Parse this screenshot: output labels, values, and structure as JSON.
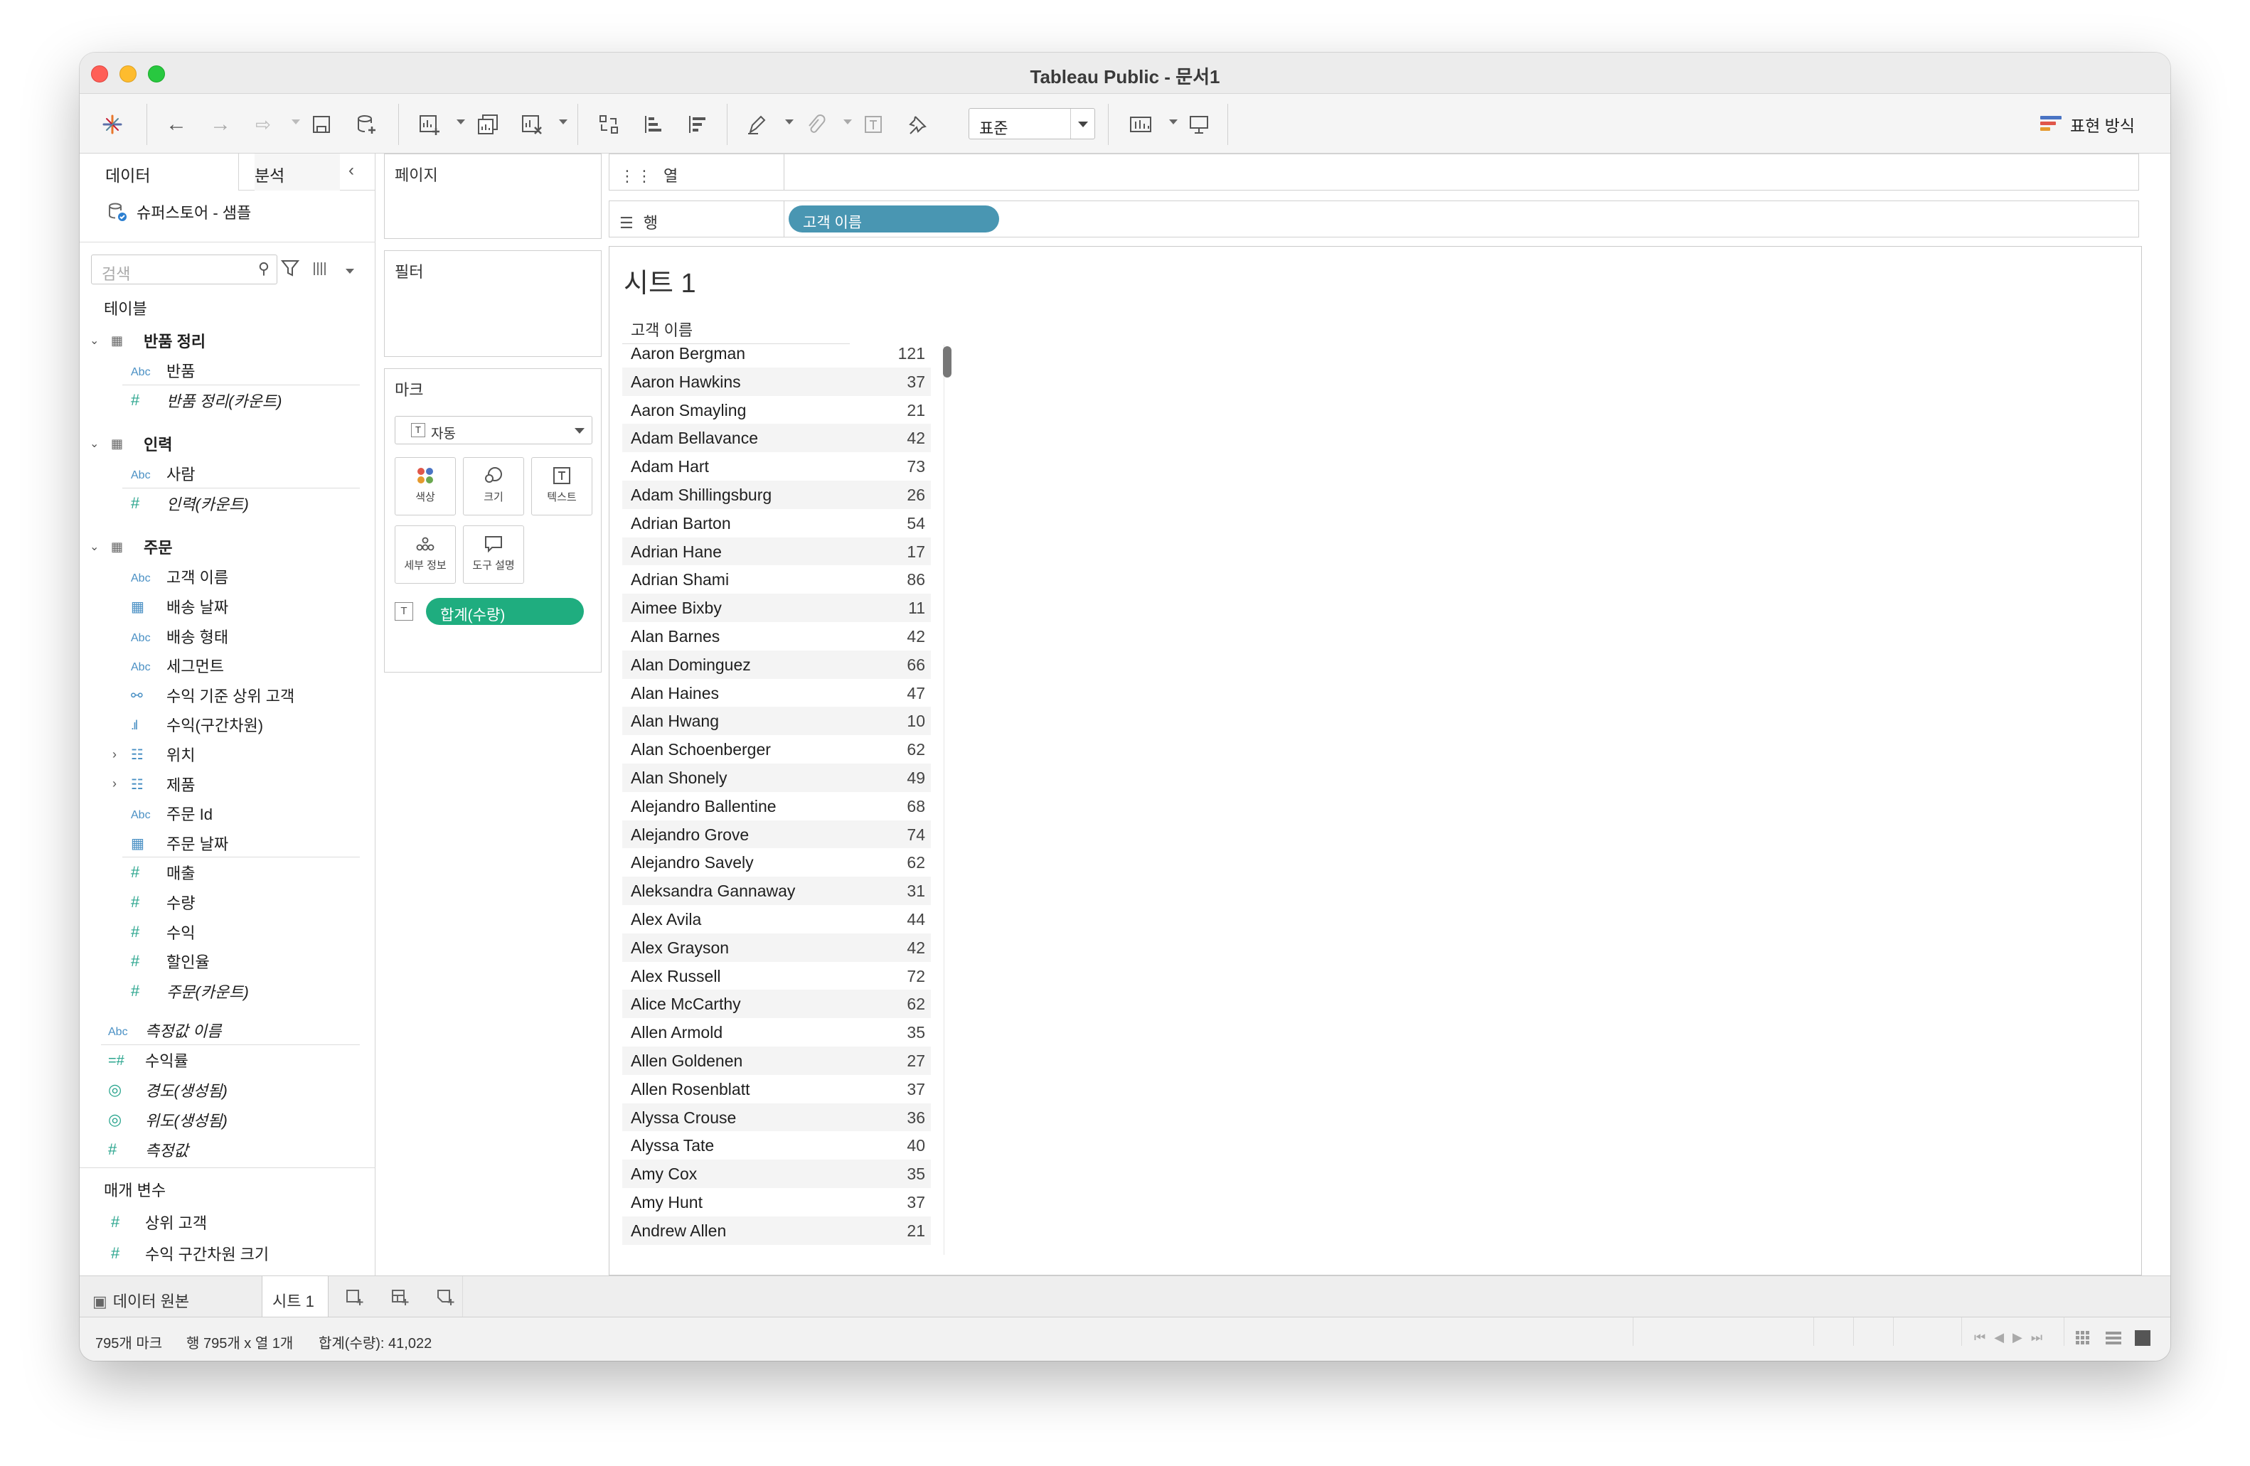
{
  "window": {
    "title": "Tableau Public - 문서1"
  },
  "toolbar": {
    "standard_select": "표준",
    "show_me": "표현 방식"
  },
  "leftpane": {
    "tab_data": "데이터",
    "tab_analysis": "분석",
    "datasource": "슈퍼스토어 - 샘플",
    "search_placeholder": "검색",
    "tables_label": "테이블",
    "groups": [
      {
        "name": "반품 정리",
        "fields": [
          {
            "t": "Abc",
            "name": "반품",
            "italic": false
          },
          {
            "t": "#",
            "name": "반품 정리(카운트)",
            "italic": true
          }
        ]
      },
      {
        "name": "인력",
        "fields": [
          {
            "t": "Abc",
            "name": "사람",
            "italic": false
          },
          {
            "t": "#",
            "name": "인력(카운트)",
            "italic": true
          }
        ]
      },
      {
        "name": "주문",
        "fields": [
          {
            "t": "Abc",
            "name": "고객 이름",
            "italic": false
          },
          {
            "t": "cal",
            "name": "배송 날짜",
            "italic": false
          },
          {
            "t": "Abc",
            "name": "배송 형태",
            "italic": false
          },
          {
            "t": "Abc",
            "name": "세그먼트",
            "italic": false
          },
          {
            "t": "set",
            "name": "수익 기준 상위 고객",
            "italic": false
          },
          {
            "t": "bin",
            "name": "수익(구간차원)",
            "italic": false
          },
          {
            "t": "hier",
            "name": "위치",
            "italic": false
          },
          {
            "t": "hier",
            "name": "제품",
            "italic": false
          },
          {
            "t": "Abc",
            "name": "주문 Id",
            "italic": false
          },
          {
            "t": "cal",
            "name": "주문 날짜",
            "italic": false
          },
          {
            "t": "#",
            "name": "매출",
            "italic": false
          },
          {
            "t": "#",
            "name": "수량",
            "italic": false
          },
          {
            "t": "#",
            "name": "수익",
            "italic": false
          },
          {
            "t": "#",
            "name": "할인율",
            "italic": false
          },
          {
            "t": "#",
            "name": "주문(카운트)",
            "italic": true
          }
        ]
      }
    ],
    "extra_fields": [
      {
        "t": "Abc",
        "name": "측정값 이름",
        "italic": true
      },
      {
        "t": "calc",
        "name": "수익률",
        "italic": false
      },
      {
        "t": "globe",
        "name": "경도(생성됨)",
        "italic": true
      },
      {
        "t": "globe",
        "name": "위도(생성됨)",
        "italic": true
      },
      {
        "t": "#",
        "name": "측정값",
        "italic": true
      }
    ],
    "params_label": "매개 변수",
    "params": [
      {
        "t": "#",
        "name": "상위 고객"
      },
      {
        "t": "#",
        "name": "수익 구간차원 크기"
      }
    ]
  },
  "shelves": {
    "pages": "페이지",
    "filters": "필터",
    "marks": "마크",
    "mark_type": "자동",
    "mark_buttons": [
      "색상",
      "크기",
      "텍스트",
      "세부 정보",
      "도구 설명"
    ],
    "mark_pill": "합계(수량)",
    "columns_label": "열",
    "rows_label": "행",
    "rows_pill": "고객 이름"
  },
  "sheet": {
    "title": "시트 1",
    "column_header": "고객 이름",
    "rows": [
      [
        "Aaron Bergman",
        "121"
      ],
      [
        "Aaron Hawkins",
        "37"
      ],
      [
        "Aaron Smayling",
        "21"
      ],
      [
        "Adam Bellavance",
        "42"
      ],
      [
        "Adam Hart",
        "73"
      ],
      [
        "Adam Shillingsburg",
        "26"
      ],
      [
        "Adrian Barton",
        "54"
      ],
      [
        "Adrian Hane",
        "17"
      ],
      [
        "Adrian Shami",
        "86"
      ],
      [
        "Aimee Bixby",
        "11"
      ],
      [
        "Alan Barnes",
        "42"
      ],
      [
        "Alan Dominguez",
        "66"
      ],
      [
        "Alan Haines",
        "47"
      ],
      [
        "Alan Hwang",
        "10"
      ],
      [
        "Alan Schoenberger",
        "62"
      ],
      [
        "Alan Shonely",
        "49"
      ],
      [
        "Alejandro Ballentine",
        "68"
      ],
      [
        "Alejandro Grove",
        "74"
      ],
      [
        "Alejandro Savely",
        "62"
      ],
      [
        "Aleksandra Gannaway",
        "31"
      ],
      [
        "Alex Avila",
        "44"
      ],
      [
        "Alex Grayson",
        "42"
      ],
      [
        "Alex Russell",
        "72"
      ],
      [
        "Alice McCarthy",
        "62"
      ],
      [
        "Allen Armold",
        "35"
      ],
      [
        "Allen Goldenen",
        "27"
      ],
      [
        "Allen Rosenblatt",
        "37"
      ],
      [
        "Alyssa Crouse",
        "36"
      ],
      [
        "Alyssa Tate",
        "40"
      ],
      [
        "Amy Cox",
        "35"
      ],
      [
        "Amy Hunt",
        "37"
      ],
      [
        "Andrew Allen",
        "21"
      ]
    ]
  },
  "tabs": {
    "datasource": "데이터 원본",
    "sheet1": "시트 1"
  },
  "status": {
    "marks": "795개 마크",
    "dims": "행 795개 x 열 1개",
    "sum": "합계(수량): 41,022"
  },
  "colors": {
    "dimension_pill": "#4996b2",
    "measure_pill": "#1fad7f"
  }
}
